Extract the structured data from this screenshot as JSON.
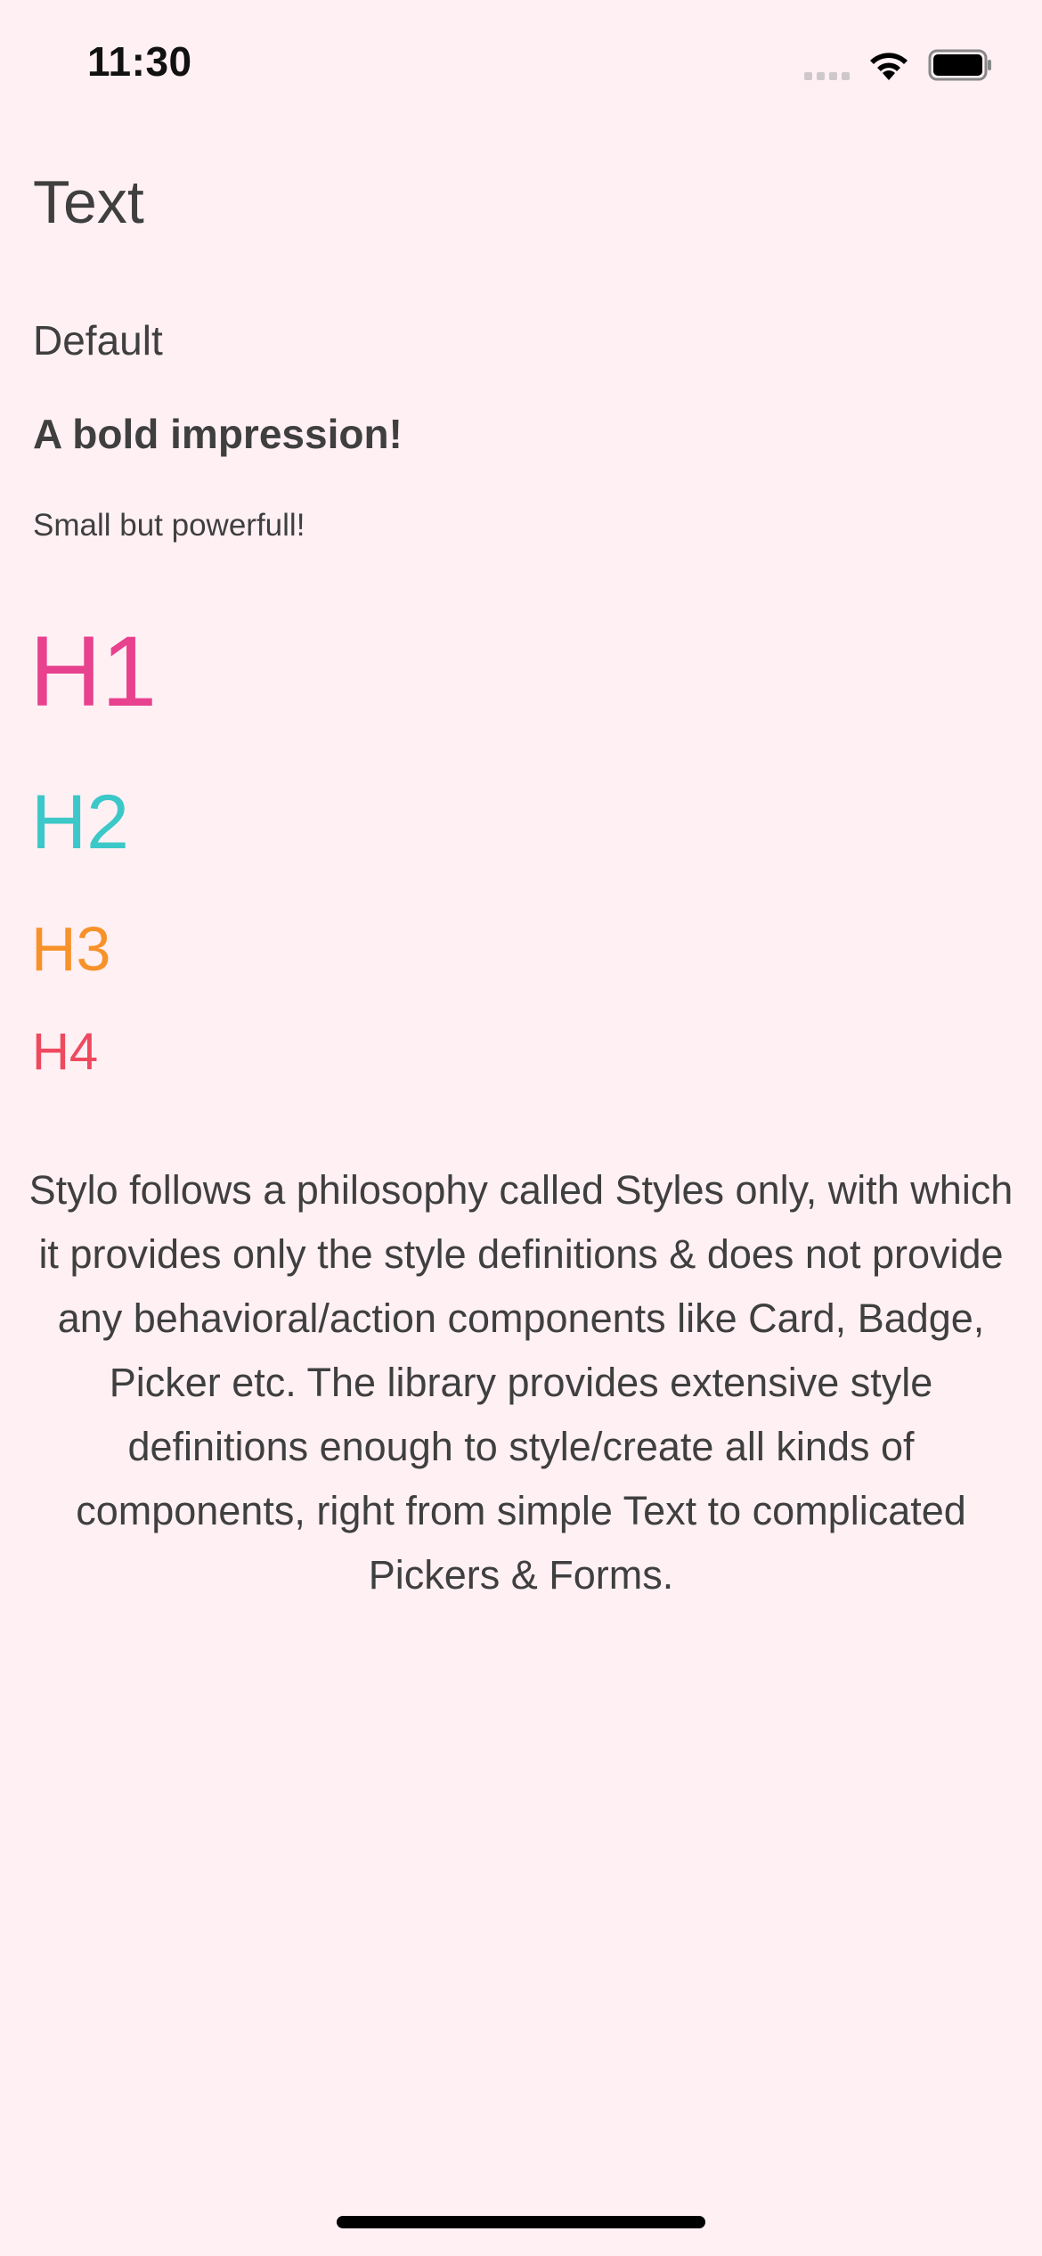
{
  "status_bar": {
    "time": "11:30"
  },
  "icons": {
    "signal": "cellular-signal-icon",
    "wifi": "wifi-icon",
    "battery": "battery-icon"
  },
  "page": {
    "title": "Text",
    "default_text": "Default",
    "bold_text": "A bold impression!",
    "small_text": "Small but powerfull!",
    "headings": [
      {
        "label": "H1",
        "color": "#e8418e"
      },
      {
        "label": "H2",
        "color": "#3cc8c8"
      },
      {
        "label": "H3",
        "color": "#f7922b"
      },
      {
        "label": "H4",
        "color": "#ee4a5f"
      }
    ],
    "paragraph": "Stylo follows a philosophy called Styles only, with which it provides only the style definitions & does not provide any behavioral/action components like Card, Badge, Picker etc. The library provides extensive style definitions enough to style/create all kinds of components, right from simple Text to complicated Pickers & Forms."
  },
  "colors": {
    "background": "#fff0f4",
    "text": "#3f3f3f"
  }
}
